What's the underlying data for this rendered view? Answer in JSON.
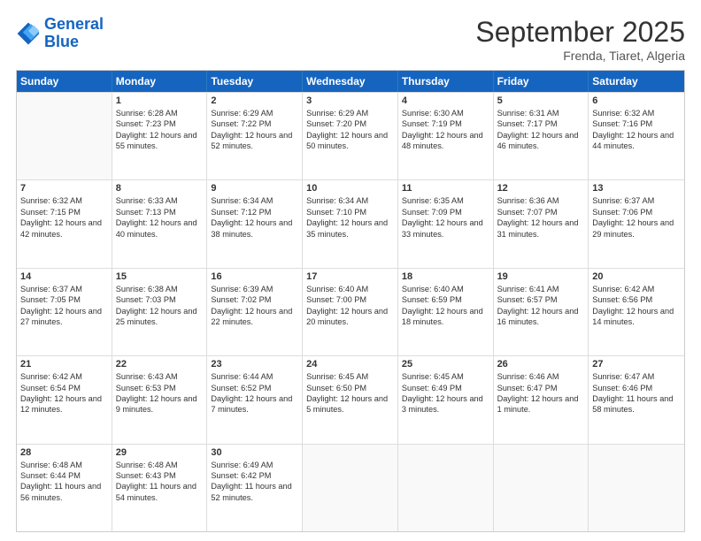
{
  "header": {
    "logo_line1": "General",
    "logo_line2": "Blue",
    "month": "September 2025",
    "location": "Frenda, Tiaret, Algeria"
  },
  "days_of_week": [
    "Sunday",
    "Monday",
    "Tuesday",
    "Wednesday",
    "Thursday",
    "Friday",
    "Saturday"
  ],
  "weeks": [
    [
      {
        "day": "",
        "empty": true
      },
      {
        "day": "1",
        "sunrise": "6:28 AM",
        "sunset": "7:23 PM",
        "daylight": "12 hours and 55 minutes."
      },
      {
        "day": "2",
        "sunrise": "6:29 AM",
        "sunset": "7:22 PM",
        "daylight": "12 hours and 52 minutes."
      },
      {
        "day": "3",
        "sunrise": "6:29 AM",
        "sunset": "7:20 PM",
        "daylight": "12 hours and 50 minutes."
      },
      {
        "day": "4",
        "sunrise": "6:30 AM",
        "sunset": "7:19 PM",
        "daylight": "12 hours and 48 minutes."
      },
      {
        "day": "5",
        "sunrise": "6:31 AM",
        "sunset": "7:17 PM",
        "daylight": "12 hours and 46 minutes."
      },
      {
        "day": "6",
        "sunrise": "6:32 AM",
        "sunset": "7:16 PM",
        "daylight": "12 hours and 44 minutes."
      }
    ],
    [
      {
        "day": "7",
        "sunrise": "6:32 AM",
        "sunset": "7:15 PM",
        "daylight": "12 hours and 42 minutes."
      },
      {
        "day": "8",
        "sunrise": "6:33 AM",
        "sunset": "7:13 PM",
        "daylight": "12 hours and 40 minutes."
      },
      {
        "day": "9",
        "sunrise": "6:34 AM",
        "sunset": "7:12 PM",
        "daylight": "12 hours and 38 minutes."
      },
      {
        "day": "10",
        "sunrise": "6:34 AM",
        "sunset": "7:10 PM",
        "daylight": "12 hours and 35 minutes."
      },
      {
        "day": "11",
        "sunrise": "6:35 AM",
        "sunset": "7:09 PM",
        "daylight": "12 hours and 33 minutes."
      },
      {
        "day": "12",
        "sunrise": "6:36 AM",
        "sunset": "7:07 PM",
        "daylight": "12 hours and 31 minutes."
      },
      {
        "day": "13",
        "sunrise": "6:37 AM",
        "sunset": "7:06 PM",
        "daylight": "12 hours and 29 minutes."
      }
    ],
    [
      {
        "day": "14",
        "sunrise": "6:37 AM",
        "sunset": "7:05 PM",
        "daylight": "12 hours and 27 minutes."
      },
      {
        "day": "15",
        "sunrise": "6:38 AM",
        "sunset": "7:03 PM",
        "daylight": "12 hours and 25 minutes."
      },
      {
        "day": "16",
        "sunrise": "6:39 AM",
        "sunset": "7:02 PM",
        "daylight": "12 hours and 22 minutes."
      },
      {
        "day": "17",
        "sunrise": "6:40 AM",
        "sunset": "7:00 PM",
        "daylight": "12 hours and 20 minutes."
      },
      {
        "day": "18",
        "sunrise": "6:40 AM",
        "sunset": "6:59 PM",
        "daylight": "12 hours and 18 minutes."
      },
      {
        "day": "19",
        "sunrise": "6:41 AM",
        "sunset": "6:57 PM",
        "daylight": "12 hours and 16 minutes."
      },
      {
        "day": "20",
        "sunrise": "6:42 AM",
        "sunset": "6:56 PM",
        "daylight": "12 hours and 14 minutes."
      }
    ],
    [
      {
        "day": "21",
        "sunrise": "6:42 AM",
        "sunset": "6:54 PM",
        "daylight": "12 hours and 12 minutes."
      },
      {
        "day": "22",
        "sunrise": "6:43 AM",
        "sunset": "6:53 PM",
        "daylight": "12 hours and 9 minutes."
      },
      {
        "day": "23",
        "sunrise": "6:44 AM",
        "sunset": "6:52 PM",
        "daylight": "12 hours and 7 minutes."
      },
      {
        "day": "24",
        "sunrise": "6:45 AM",
        "sunset": "6:50 PM",
        "daylight": "12 hours and 5 minutes."
      },
      {
        "day": "25",
        "sunrise": "6:45 AM",
        "sunset": "6:49 PM",
        "daylight": "12 hours and 3 minutes."
      },
      {
        "day": "26",
        "sunrise": "6:46 AM",
        "sunset": "6:47 PM",
        "daylight": "12 hours and 1 minute."
      },
      {
        "day": "27",
        "sunrise": "6:47 AM",
        "sunset": "6:46 PM",
        "daylight": "11 hours and 58 minutes."
      }
    ],
    [
      {
        "day": "28",
        "sunrise": "6:48 AM",
        "sunset": "6:44 PM",
        "daylight": "11 hours and 56 minutes."
      },
      {
        "day": "29",
        "sunrise": "6:48 AM",
        "sunset": "6:43 PM",
        "daylight": "11 hours and 54 minutes."
      },
      {
        "day": "30",
        "sunrise": "6:49 AM",
        "sunset": "6:42 PM",
        "daylight": "11 hours and 52 minutes."
      },
      {
        "day": "",
        "empty": true
      },
      {
        "day": "",
        "empty": true
      },
      {
        "day": "",
        "empty": true
      },
      {
        "day": "",
        "empty": true
      }
    ]
  ]
}
